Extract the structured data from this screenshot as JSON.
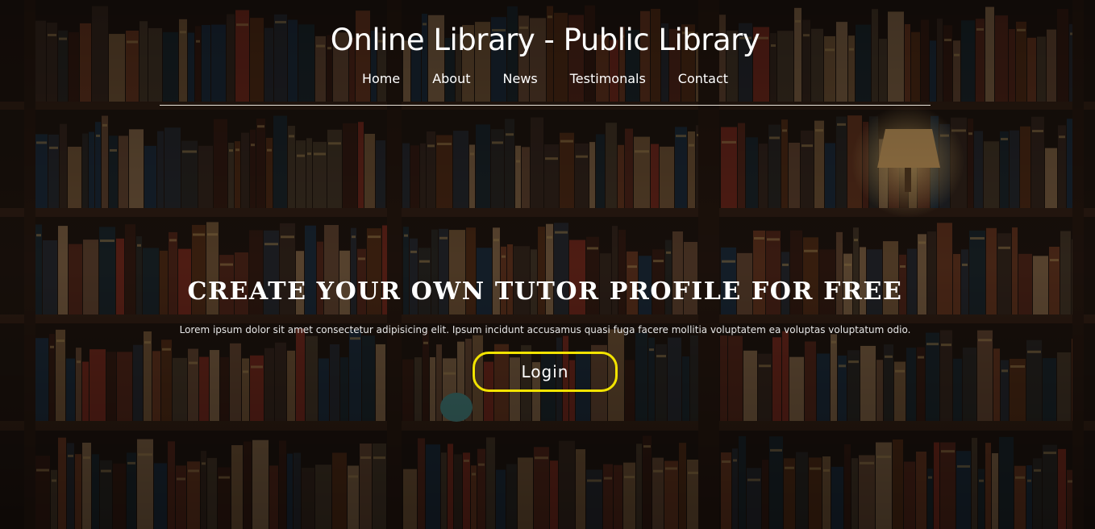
{
  "header": {
    "title": "Online Library - Public Library"
  },
  "nav": {
    "items": [
      "Home",
      "About",
      "News",
      "Testimonals",
      "Contact"
    ]
  },
  "hero": {
    "headline": "CREATE YOUR OWN TUTOR PROFILE FOR FREE",
    "text": "Lorem ipsum dolor sit amet consectetur adipisicing elit. Ipsum incidunt accusamus quasi fuga facere mollitia voluptatem ea voluptas voluptatum odio.",
    "button_label": "Login"
  },
  "colors": {
    "button_border": "#f2e300",
    "text": "#ffffff",
    "divider": "#e8e2d8"
  }
}
